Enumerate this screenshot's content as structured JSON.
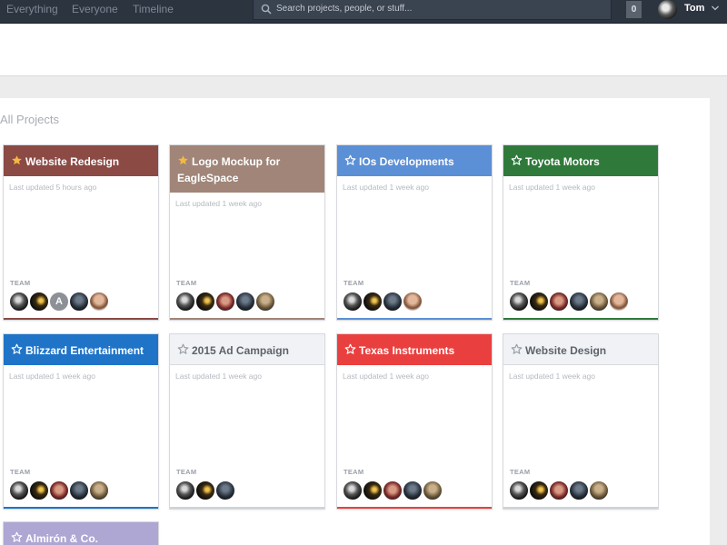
{
  "nav": {
    "links": [
      "Everything",
      "Everyone",
      "Timeline"
    ],
    "search_placeholder": "Search projects, people, or stuff...",
    "notification_count": "0",
    "user_name": "Tom"
  },
  "page": {
    "title": "All Projects"
  },
  "labels": {
    "team": "TEAM"
  },
  "colors": {
    "topbar": "#2c3440",
    "star_gold": "#f4b844",
    "star_gray": "#9aa0a8"
  },
  "projects": [
    {
      "name": "Website Redesign",
      "updated": "Last updated 5 hours ago",
      "header_color": "#8c4a45",
      "text_color": "#ffffff",
      "starred": true,
      "avatars": [
        "dark-a",
        "dark-b",
        "letter-a",
        "dark-c",
        "face-e"
      ],
      "bottom_color": "#8c4a45"
    },
    {
      "name": "Logo Mockup for EagleSpace",
      "updated": "Last updated 1 week ago",
      "header_color": "#a08578",
      "text_color": "#ffffff",
      "starred": true,
      "avatars": [
        "dark-a",
        "dark-b",
        "face-r",
        "dark-c",
        "face-g"
      ],
      "bottom_color": "#a08578"
    },
    {
      "name": "IOs Developments",
      "updated": "Last updated 1 week ago",
      "header_color": "#5b8fd6",
      "text_color": "#ffffff",
      "starred": false,
      "avatars": [
        "dark-a",
        "dark-b",
        "dark-c",
        "face-e"
      ],
      "bottom_color": "#5b8fd6"
    },
    {
      "name": "Toyota Motors",
      "updated": "Last updated 1 week ago",
      "header_color": "#2f7a3b",
      "text_color": "#ffffff",
      "starred": false,
      "avatars": [
        "dark-a",
        "dark-b",
        "face-r",
        "dark-c",
        "face-g",
        "face-e"
      ],
      "bottom_color": "#2f7a3b"
    },
    {
      "name": "Blizzard Entertainment",
      "updated": "Last updated 1 week ago",
      "header_color": "#1f74c8",
      "text_color": "#ffffff",
      "starred": false,
      "avatars": [
        "dark-a",
        "dark-b",
        "face-r",
        "dark-c",
        "face-g"
      ],
      "bottom_color": "#1f74c8"
    },
    {
      "name": "2015 Ad Campaign",
      "updated": "Last updated 1 week ago",
      "header_color": "#f1f2f5",
      "text_color": "#5e636b",
      "starred": false,
      "avatars": [
        "dark-a",
        "dark-b",
        "dark-c"
      ],
      "bottom_color": "#cfd2d8"
    },
    {
      "name": "Texas Instruments",
      "updated": "Last updated 1 week ago",
      "header_color": "#e9403f",
      "text_color": "#ffffff",
      "starred": false,
      "avatars": [
        "dark-a",
        "dark-b",
        "face-r",
        "dark-c",
        "face-g"
      ],
      "bottom_color": "#e9403f"
    },
    {
      "name": "Website Design",
      "updated": "Last updated 1 week ago",
      "header_color": "#f1f2f5",
      "text_color": "#5e636b",
      "starred": false,
      "avatars": [
        "dark-a",
        "dark-b",
        "face-r",
        "dark-c",
        "face-g"
      ],
      "bottom_color": "#cfd2d8"
    },
    {
      "name": "Almirón & Co.",
      "updated": "",
      "header_color": "#aea6d3",
      "text_color": "#ffffff",
      "starred": false,
      "avatars": [],
      "bottom_color": "#aea6d3"
    }
  ]
}
